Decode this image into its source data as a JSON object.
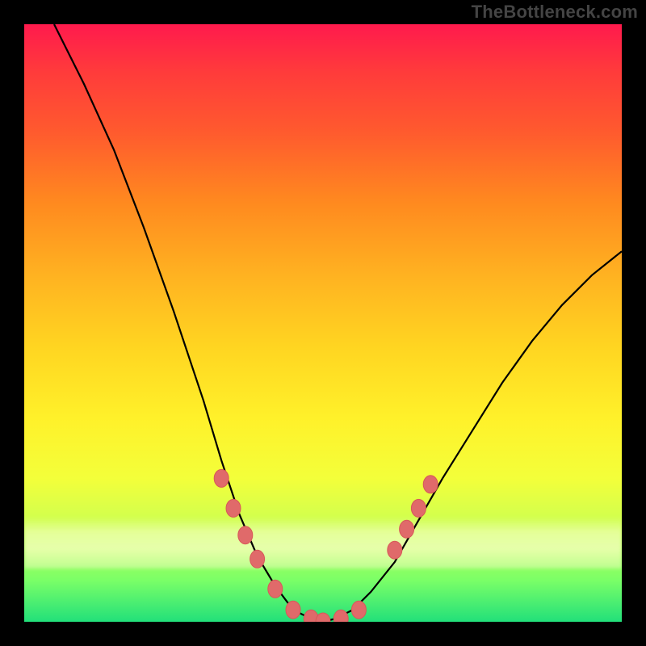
{
  "watermark": "TheBottleneck.com",
  "chart_data": {
    "type": "line",
    "title": "",
    "xlabel": "",
    "ylabel": "",
    "xlim": [
      0,
      100
    ],
    "ylim": [
      0,
      100
    ],
    "background_gradient": {
      "top_color": "#ff1a4d",
      "bottom_color": "#22e07a",
      "description": "vertical red→orange→yellow→green heat gradient"
    },
    "series": [
      {
        "name": "bottleneck-curve",
        "description": "V-shaped compatibility / bottleneck curve; minimum ≈ 0 around x≈45–55",
        "x": [
          5,
          10,
          15,
          20,
          25,
          30,
          33,
          36,
          39,
          42,
          45,
          48,
          50,
          52,
          55,
          58,
          62,
          66,
          70,
          75,
          80,
          85,
          90,
          95,
          100
        ],
        "y": [
          100,
          90,
          79,
          66,
          52,
          37,
          27,
          18,
          11,
          6,
          2,
          0.5,
          0,
          0.5,
          2,
          5,
          10,
          17,
          24,
          32,
          40,
          47,
          53,
          58,
          62
        ]
      }
    ],
    "markers": {
      "name": "highlighted-points",
      "description": "pink bead markers near the curve trough",
      "x": [
        33,
        35,
        37,
        39,
        42,
        45,
        48,
        50,
        53,
        56,
        62,
        64,
        66,
        68
      ],
      "y": [
        24,
        19,
        14.5,
        10.5,
        5.5,
        2,
        0.5,
        0,
        0.5,
        2,
        12,
        15.5,
        19,
        23
      ]
    }
  }
}
